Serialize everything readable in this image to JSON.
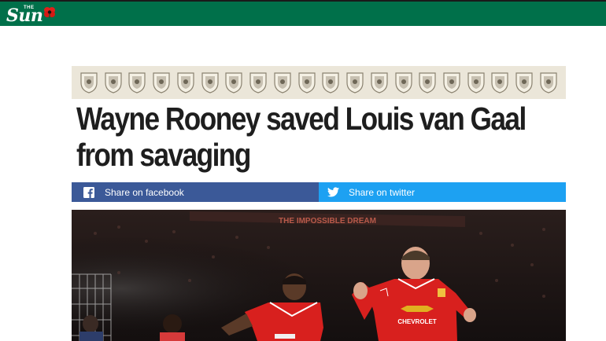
{
  "brand": {
    "small": "THE",
    "word": "Sun"
  },
  "crests": [
    "arsenal-crest-icon",
    "aston-villa-crest-icon",
    "bournemouth-crest-icon",
    "chelsea-crest-icon",
    "crystal-palace-crest-icon",
    "everton-crest-icon",
    "leicester-crest-icon",
    "liverpool-crest-icon",
    "man-city-crest-icon",
    "man-united-crest-icon",
    "newcastle-crest-icon",
    "norwich-crest-icon",
    "southampton-crest-icon",
    "stoke-crest-icon",
    "sunderland-crest-icon",
    "swansea-crest-icon",
    "tottenham-crest-icon",
    "watford-crest-icon",
    "west-brom-crest-icon",
    "west-ham-crest-icon"
  ],
  "article": {
    "headline": "Wayne Rooney saved Louis van Gaal from savaging"
  },
  "share": {
    "facebook": {
      "label": "Share on facebook",
      "color": "#3b5998"
    },
    "twitter": {
      "label": "Share on twitter",
      "color": "#1da1f2"
    }
  },
  "photo": {
    "sponsor_text": "CHEVROLET",
    "banner_text": "THE IMPOSSIBLE DREAM"
  },
  "colors": {
    "topbar": "#00704a",
    "strip": "#ebe6d9",
    "headline": "#1e1e1e"
  }
}
